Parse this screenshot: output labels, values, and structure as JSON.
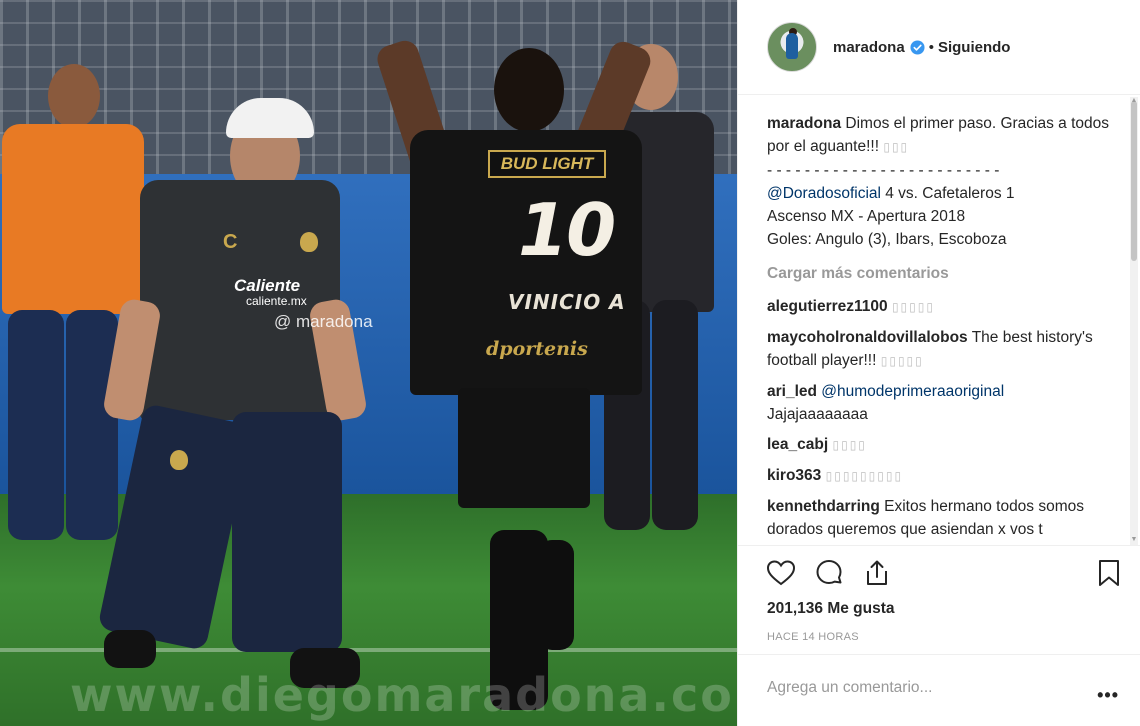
{
  "photo": {
    "watermark": "@ maradona",
    "footer_mark": "www.diegomaradona.com",
    "shirt_brand_top": "Caliente",
    "shirt_brand_sub": "caliente.mx",
    "shirt_logo": "C",
    "jersey_sponsor": "BUD LIGHT",
    "jersey_number": "10",
    "jersey_name": "VINICIO A",
    "jersey_brand": "dportenis"
  },
  "header": {
    "username": "maradona",
    "separator": "•",
    "follow_state": "Siguiendo",
    "avatar_icon": "profile-photo",
    "verified_icon": "verified-badge-icon",
    "verified_color": "#3897f0"
  },
  "caption": {
    "user": "maradona",
    "line1": "Dimos el primer paso. Gracias a todos por el aguante!!!",
    "emoji1": "▯▯▯",
    "divider": "- - - - - - - - - - - - - - - - - - - - - - - - -",
    "mention": "@Doradosoficial",
    "line2": " 4 vs. Cafetaleros 1",
    "line3": "Ascenso MX - Apertura 2018",
    "line4": "Goles: Angulo (3), Ibars, Escoboza"
  },
  "load_more": "Cargar más comentarios",
  "comments": [
    {
      "user": "alegutierrez1100",
      "text": "",
      "emoji": "▯▯▯▯▯"
    },
    {
      "user": "maycoholronaldovillalobos",
      "text": "The best history's football player!!!",
      "emoji": "▯▯▯▯▯"
    },
    {
      "user": "ari_led",
      "mention": "@humodeprimeraaoriginal",
      "text": "Jajajaaaaaaaa",
      "emoji": ""
    },
    {
      "user": "lea_cabj",
      "text": "",
      "emoji": "▯▯▯▯"
    },
    {
      "user": "kiro363",
      "text": "",
      "emoji": "▯▯▯▯▯▯▯▯▯"
    },
    {
      "user": "kennethdarring",
      "text": "Exitos hermano todos somos dorados queremos que asiendan x vos t queremos feliz haci nos mantenemos",
      "emoji": ""
    }
  ],
  "actions": {
    "like_icon": "heart-icon",
    "comment_icon": "comment-bubble-icon",
    "share_icon": "share-upload-icon",
    "save_icon": "bookmark-icon",
    "likes_label": "201,136 Me gusta",
    "time_ago": "HACE 14 HORAS"
  },
  "add_comment": {
    "placeholder": "Agrega un comentario...",
    "more_label": "•••"
  },
  "colors": {
    "accent_link": "#003569",
    "verified": "#3897f0",
    "muted": "#999999"
  }
}
